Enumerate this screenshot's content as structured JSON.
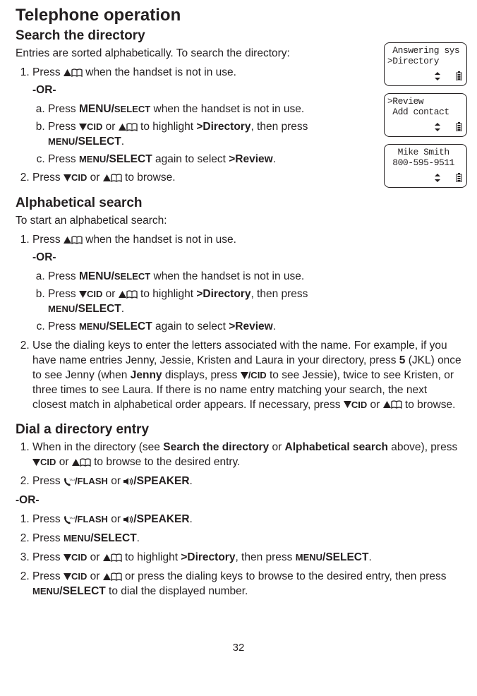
{
  "title": "Telephone operation",
  "page_number": "32",
  "search_directory": {
    "heading": "Search the directory",
    "intro": "Entries are sorted alphabetically. To search the directory:",
    "step1_pre": "Press ",
    "step1_post": " when the handset is not in use.",
    "or": "-OR-",
    "a_pre": "Press ",
    "a_bold": "MENU/",
    "a_small": "SELECT",
    "a_post": " when the handset is not in use.",
    "b_pre": "Press ",
    "b_cid": "CID",
    "b_mid": " or ",
    "b_highlight_pre": " to highlight ",
    "b_dir": ">Directory",
    "b_then": ", then press ",
    "b_menu": "MENU",
    "b_select": "/SELECT",
    "b_period": ".",
    "c_pre": "Press ",
    "c_menu": "MENU",
    "c_select": "/SELECT",
    "c_again": " again to select ",
    "c_review": ">Review",
    "c_period": ".",
    "step2_pre": "Press ",
    "step2_cid": "CID",
    "step2_or": " or ",
    "step2_post": " to browse."
  },
  "alpha": {
    "heading": "Alphabetical search",
    "intro": "To start an alphabetical search:",
    "step1_pre": "Press ",
    "step1_post": " when the handset is not in use.",
    "or": "-OR-",
    "a_pre": "Press ",
    "a_bold": "MENU/",
    "a_small": "SELECT",
    "a_post": " when the handset is not in use.",
    "b_pre": "Press ",
    "b_cid": "CID",
    "b_mid": " or ",
    "b_highlight_pre": " to highlight ",
    "b_dir": ">Directory",
    "b_then": ", then press ",
    "b_menu": "MENU",
    "b_select": "/SELECT",
    "b_period": ".",
    "c_pre": "Press ",
    "c_menu": "MENU",
    "c_select": "/SELECT",
    "c_again": " again to select ",
    "c_review": ">Review",
    "c_period": ".",
    "step2_a": "Use the dialing keys to enter the letters associated with the name. For example, if you have name entries Jenny, Jessie, Kristen and Laura in your directory, press ",
    "step2_5": "5",
    "step2_b": " (JKL) once to see Jenny (when ",
    "step2_jenny": "Jenny",
    "step2_c": " displays, press ",
    "step2_cid": "/CID",
    "step2_d": " to see Jessie), twice to see Kristen, or three times to see Laura. If there is no name entry matching your search, the next closest match in alphabetical order appears. If necessary, press ",
    "step2_cid2": "CID",
    "step2_or": " or ",
    "step2_e": " to browse."
  },
  "dial": {
    "heading": "Dial a directory entry",
    "s1_a": "When in the directory (see ",
    "s1_b": "Search the directory",
    "s1_c": " or ",
    "s1_d": "Alphabetical search",
    "s1_e": " above), press ",
    "s1_cid": "CID",
    "s1_f": " or ",
    "s1_g": " to browse to the desired entry.",
    "s2_a": "Press ",
    "s2_talk": "/FLASH",
    "s2_b": " or ",
    "s2_spk": "/SPEAKER",
    "s2_c": ".",
    "or": "-OR-",
    "s3_a": "Press ",
    "s3_talk": "/FLASH",
    "s3_b": " or ",
    "s3_spk": "/SPEAKER",
    "s3_c": ".",
    "s4_a": "Press ",
    "s4_menu": "MENU",
    "s4_select": "/SELECT",
    "s4_b": ".",
    "s5_a": "Press ",
    "s5_cid": "CID",
    "s5_b": " or ",
    "s5_c": " to highlight ",
    "s5_dir": ">Directory",
    "s5_d": ", then press ",
    "s5_menu": "MENU",
    "s5_select": "/SELECT",
    "s5_e": ".",
    "s6_a": "Press ",
    "s6_cid": "CID",
    "s6_b": " or ",
    "s6_c": " or press the dialing keys to browse to the desired entry, then press ",
    "s6_menu": "MENU",
    "s6_select": "/SELECT",
    "s6_d": " to dial the displayed number."
  },
  "lcd1": {
    "line1": " Answering sys",
    "line2": ">Directory"
  },
  "lcd2": {
    "line1": ">Review",
    "line2": " Add contact"
  },
  "lcd3": {
    "line1": "  Mike Smith",
    "line2": " 800-595-9511"
  }
}
